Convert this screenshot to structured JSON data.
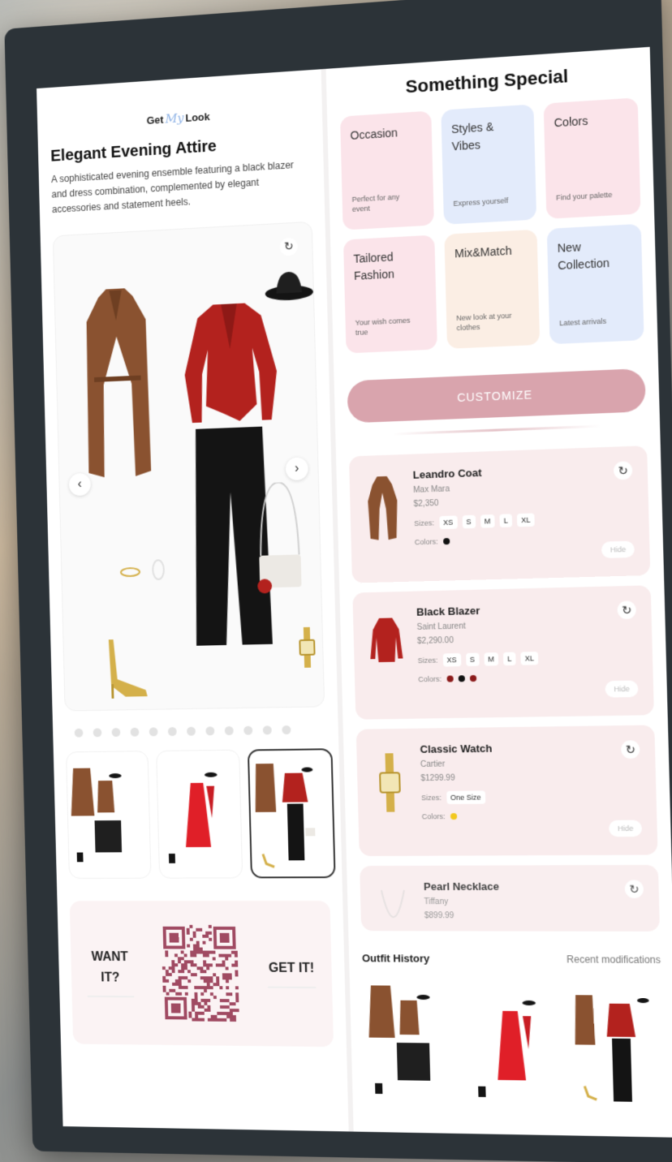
{
  "brand": {
    "prefix": "Get",
    "script": "My",
    "suffix": "Look"
  },
  "outfit": {
    "title": "Elegant Evening Attire",
    "description": "A sophisticated evening ensemble featuring a black blazer and dress combination, complemented by elegant accessories and statement heels."
  },
  "carousel": {
    "prev_icon": "‹",
    "next_icon": "›",
    "refresh_icon": "↻",
    "dot_count": 12,
    "active_thumb_index": 2
  },
  "cta": {
    "want": "WANT IT?",
    "get": "GET IT!"
  },
  "special": {
    "title": "Something Special",
    "tiles": [
      {
        "title": "Occasion",
        "subtitle": "Perfect for any event",
        "color": "pink"
      },
      {
        "title": "Styles & Vibes",
        "subtitle": "Express yourself",
        "color": "blue"
      },
      {
        "title": "Colors",
        "subtitle": "Find your palette",
        "color": "pink"
      },
      {
        "title": "Tailored Fashion",
        "subtitle": "Your wish comes true",
        "color": "pink"
      },
      {
        "title": "Mix&Match",
        "subtitle": "New look at your clothes",
        "color": "peach"
      },
      {
        "title": "New Collection",
        "subtitle": "Latest arrivals",
        "color": "blue"
      }
    ],
    "customize_label": "CUSTOMIZE"
  },
  "items": [
    {
      "name": "Leandro Coat",
      "brand": "Max Mara",
      "price": "$2,350",
      "sizes_label": "Sizes:",
      "sizes": [
        "XS",
        "S",
        "M",
        "L",
        "XL"
      ],
      "colors_label": "Colors:",
      "colors": [
        "#111111"
      ],
      "hide": "Hide"
    },
    {
      "name": "Black Blazer",
      "brand": "Saint Laurent",
      "price": "$2,290.00",
      "sizes_label": "Sizes:",
      "sizes": [
        "XS",
        "S",
        "M",
        "L",
        "XL"
      ],
      "colors_label": "Colors:",
      "colors": [
        "#8b1a1a",
        "#111111",
        "#8b1a1a"
      ],
      "hide": "Hide"
    },
    {
      "name": "Classic Watch",
      "brand": "Cartier",
      "price": "$1299.99",
      "sizes_label": "Sizes:",
      "sizes": [
        "One Size"
      ],
      "colors_label": "Colors:",
      "colors": [
        "#f2c81f"
      ],
      "hide": "Hide"
    },
    {
      "name": "Pearl Necklace",
      "brand": "Tiffany",
      "price": "$899.99"
    }
  ],
  "history": {
    "title": "Outfit History",
    "subtitle": "Recent modifications"
  },
  "colors": {
    "accent": "#d9a4ad",
    "coat": "#8a5230",
    "red": "#b3221e",
    "black": "#141414",
    "gold": "#d4b04a"
  }
}
